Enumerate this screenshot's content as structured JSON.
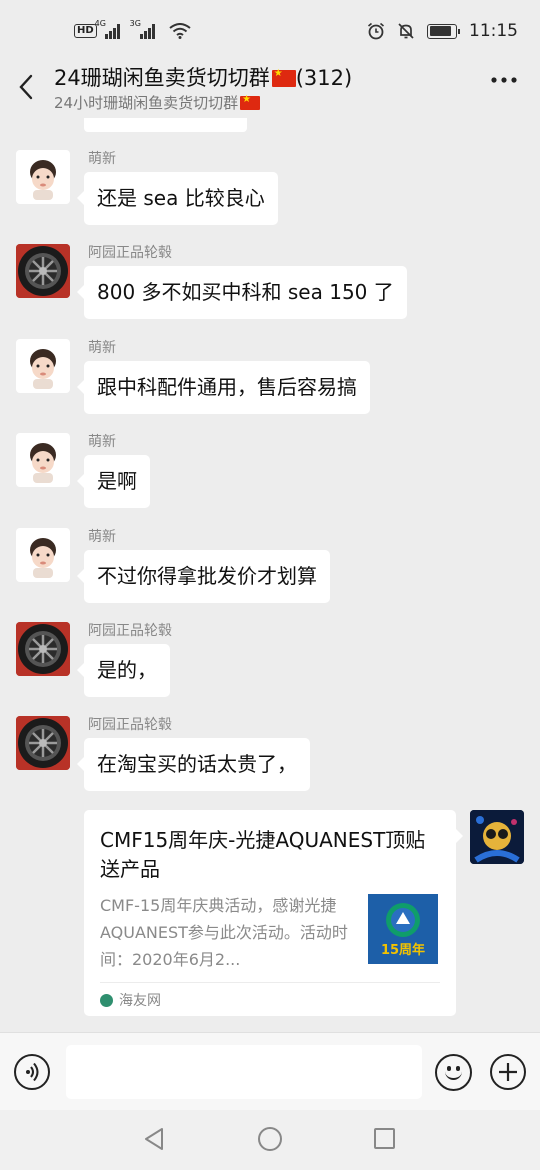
{
  "status_bar": {
    "network_1": "4G",
    "network_2": "3G",
    "time": "11:15",
    "battery_level": 0.85
  },
  "header": {
    "title": "24珊瑚闲鱼卖货切切群",
    "member_count": "(312)",
    "subtitle": "24小时珊瑚闲鱼卖货切切群",
    "back_icon": "back-chevron-icon",
    "more_icon": "more-dots-icon"
  },
  "messages": [
    {
      "sender": "萌新",
      "avatar": "baby",
      "text": "还是 sea 比较良心"
    },
    {
      "sender": "阿园正品轮毂",
      "avatar": "tire",
      "text": "800 多不如买中科和 sea 150 了"
    },
    {
      "sender": "萌新",
      "avatar": "baby",
      "text": "跟中科配件通用，售后容易搞"
    },
    {
      "sender": "萌新",
      "avatar": "baby",
      "text": "是啊"
    },
    {
      "sender": "萌新",
      "avatar": "baby",
      "text": "不过你得拿批发价才划算"
    },
    {
      "sender": "阿园正品轮毂",
      "avatar": "tire",
      "text": "是的，"
    },
    {
      "sender": "阿园正品轮毂",
      "avatar": "tire",
      "text": "在淘宝买的话太贵了，"
    }
  ],
  "link_card": {
    "title": "CMF15周年庆-光捷AQUANEST顶贴送产品",
    "description": "CMF-15周年庆典活动，感谢光捷AQUANEST参与此次活动。活动时间：2020年6月2...",
    "thumb_text": "15周年",
    "source": "海友网"
  },
  "input_bar": {
    "voice_icon": "voice-icon",
    "input_value": "",
    "emoji_icon": "emoji-icon",
    "plus_icon": "plus-icon"
  },
  "colors": {
    "background": "#ededed",
    "bubble": "#ffffff",
    "flag_red": "#de2910"
  }
}
